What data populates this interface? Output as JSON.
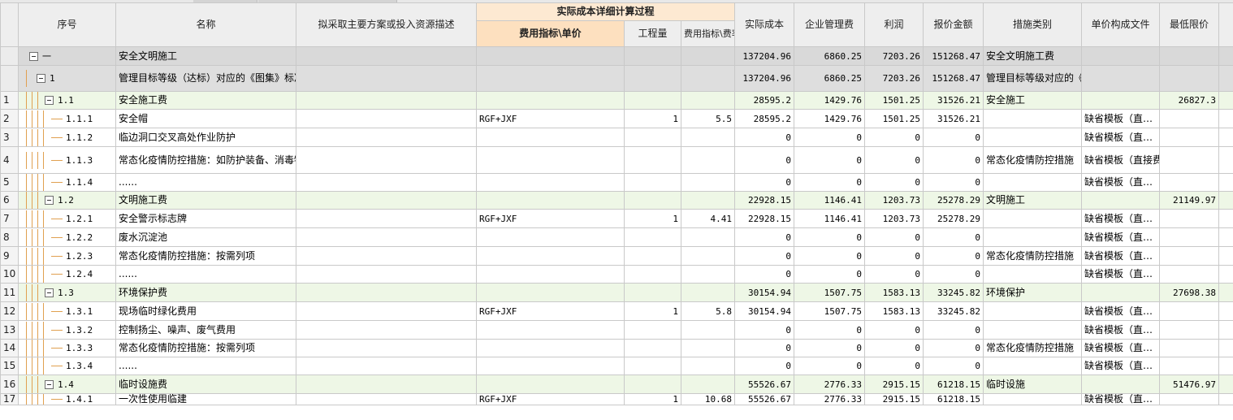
{
  "columns": {
    "seq": "序号",
    "name": "名称",
    "plan": "拟采取主要方案或投入资源描述",
    "group": "实际成本详细计算过程",
    "indicator": "费用指标\\单价",
    "quantity": "工程量",
    "rate": "费用指标\\费率(%)",
    "actual_cost": "实际成本",
    "mgmt_fee": "企业管理费",
    "profit": "利润",
    "quote": "报价金额",
    "category": "措施类别",
    "unit_doc": "单价构成文件",
    "min_price": "最低限价"
  },
  "rows": [
    {
      "idx": "",
      "code": "一",
      "level": 0,
      "toggle": true,
      "name": "安全文明施工",
      "plan": "",
      "indicator": "",
      "qty": "",
      "rate": "",
      "cost": "137204.96",
      "mgmt": "6860.25",
      "profit": "7203.26",
      "quote": "151268.47",
      "category": "安全文明施工费",
      "unitdoc": "",
      "minprice": ""
    },
    {
      "idx": "",
      "code": "1",
      "level": 1,
      "toggle": true,
      "name": "管理目标等级（达标）对应的《图集》标准内项目措施费",
      "plan": "",
      "indicator": "",
      "qty": "",
      "rate": "",
      "cost": "137204.96",
      "mgmt": "6860.25",
      "profit": "7203.26",
      "quote": "151268.47",
      "category": "管理目标等级对应的《图集》标准内项…",
      "unitdoc": "",
      "minprice": ""
    },
    {
      "idx": "1",
      "code": "1.1",
      "level": 2,
      "toggle": true,
      "name": "安全施工费",
      "plan": "",
      "indicator": "",
      "qty": "",
      "rate": "",
      "cost": "28595.2",
      "mgmt": "1429.76",
      "profit": "1501.25",
      "quote": "31526.21",
      "category": "安全施工",
      "unitdoc": "",
      "minprice": "26827.3"
    },
    {
      "idx": "2",
      "code": "1.1.1",
      "level": 3,
      "toggle": false,
      "name": "安全帽",
      "plan": "",
      "indicator": "RGF+JXF",
      "qty": "1",
      "rate": "5.5",
      "cost": "28595.2",
      "mgmt": "1429.76",
      "profit": "1501.25",
      "quote": "31526.21",
      "category": "",
      "unitdoc": "缺省模板（直…",
      "minprice": ""
    },
    {
      "idx": "3",
      "code": "1.1.2",
      "level": 3,
      "toggle": false,
      "name": "临边洞口交叉高处作业防护",
      "plan": "",
      "indicator": "",
      "qty": "",
      "rate": "",
      "cost": "0",
      "mgmt": "0",
      "profit": "0",
      "quote": "0",
      "category": "",
      "unitdoc": "缺省模板（直…",
      "minprice": ""
    },
    {
      "idx": "4",
      "code": "1.1.3",
      "level": 3,
      "toggle": false,
      "name": "常态化疫情防控措施：如防护装备、消毒物资...",
      "plan": "",
      "indicator": "",
      "qty": "",
      "rate": "",
      "cost": "0",
      "mgmt": "0",
      "profit": "0",
      "quote": "0",
      "category": "常态化疫情防控措施",
      "unitdoc": "缺省模板（直接费取费）",
      "minprice": ""
    },
    {
      "idx": "5",
      "code": "1.1.4",
      "level": 3,
      "toggle": false,
      "name": "......",
      "plan": "",
      "indicator": "",
      "qty": "",
      "rate": "",
      "cost": "0",
      "mgmt": "0",
      "profit": "0",
      "quote": "0",
      "category": "",
      "unitdoc": "缺省模板（直…",
      "minprice": ""
    },
    {
      "idx": "6",
      "code": "1.2",
      "level": 2,
      "toggle": true,
      "name": "文明施工费",
      "plan": "",
      "indicator": "",
      "qty": "",
      "rate": "",
      "cost": "22928.15",
      "mgmt": "1146.41",
      "profit": "1203.73",
      "quote": "25278.29",
      "category": "文明施工",
      "unitdoc": "",
      "minprice": "21149.97"
    },
    {
      "idx": "7",
      "code": "1.2.1",
      "level": 3,
      "toggle": false,
      "name": "安全警示标志牌",
      "plan": "",
      "indicator": "RGF+JXF",
      "qty": "1",
      "rate": "4.41",
      "cost": "22928.15",
      "mgmt": "1146.41",
      "profit": "1203.73",
      "quote": "25278.29",
      "category": "",
      "unitdoc": "缺省模板（直…",
      "minprice": ""
    },
    {
      "idx": "8",
      "code": "1.2.2",
      "level": 3,
      "toggle": false,
      "name": "废水沉淀池",
      "plan": "",
      "indicator": "",
      "qty": "",
      "rate": "",
      "cost": "0",
      "mgmt": "0",
      "profit": "0",
      "quote": "0",
      "category": "",
      "unitdoc": "缺省模板（直…",
      "minprice": ""
    },
    {
      "idx": "9",
      "code": "1.2.3",
      "level": 3,
      "toggle": false,
      "name": "常态化疫情防控措施：按需列项",
      "plan": "",
      "indicator": "",
      "qty": "",
      "rate": "",
      "cost": "0",
      "mgmt": "0",
      "profit": "0",
      "quote": "0",
      "category": "常态化疫情防控措施",
      "unitdoc": "缺省模板（直…",
      "minprice": ""
    },
    {
      "idx": "10",
      "code": "1.2.4",
      "level": 3,
      "toggle": false,
      "name": "......",
      "plan": "",
      "indicator": "",
      "qty": "",
      "rate": "",
      "cost": "0",
      "mgmt": "0",
      "profit": "0",
      "quote": "0",
      "category": "",
      "unitdoc": "缺省模板（直…",
      "minprice": ""
    },
    {
      "idx": "11",
      "code": "1.3",
      "level": 2,
      "toggle": true,
      "name": "环境保护费",
      "plan": "",
      "indicator": "",
      "qty": "",
      "rate": "",
      "cost": "30154.94",
      "mgmt": "1507.75",
      "profit": "1583.13",
      "quote": "33245.82",
      "category": "环境保护",
      "unitdoc": "",
      "minprice": "27698.38"
    },
    {
      "idx": "12",
      "code": "1.3.1",
      "level": 3,
      "toggle": false,
      "name": "现场临时绿化费用",
      "plan": "",
      "indicator": "RGF+JXF",
      "qty": "1",
      "rate": "5.8",
      "cost": "30154.94",
      "mgmt": "1507.75",
      "profit": "1583.13",
      "quote": "33245.82",
      "category": "",
      "unitdoc": "缺省模板（直…",
      "minprice": ""
    },
    {
      "idx": "13",
      "code": "1.3.2",
      "level": 3,
      "toggle": false,
      "name": "控制扬尘、噪声、废气费用",
      "plan": "",
      "indicator": "",
      "qty": "",
      "rate": "",
      "cost": "0",
      "mgmt": "0",
      "profit": "0",
      "quote": "0",
      "category": "",
      "unitdoc": "缺省模板（直…",
      "minprice": ""
    },
    {
      "idx": "14",
      "code": "1.3.3",
      "level": 3,
      "toggle": false,
      "name": "常态化疫情防控措施：按需列项",
      "plan": "",
      "indicator": "",
      "qty": "",
      "rate": "",
      "cost": "0",
      "mgmt": "0",
      "profit": "0",
      "quote": "0",
      "category": "常态化疫情防控措施",
      "unitdoc": "缺省模板（直…",
      "minprice": ""
    },
    {
      "idx": "15",
      "code": "1.3.4",
      "level": 3,
      "toggle": false,
      "name": "......",
      "plan": "",
      "indicator": "",
      "qty": "",
      "rate": "",
      "cost": "0",
      "mgmt": "0",
      "profit": "0",
      "quote": "0",
      "category": "",
      "unitdoc": "缺省模板（直…",
      "minprice": ""
    },
    {
      "idx": "16",
      "code": "1.4",
      "level": 2,
      "toggle": true,
      "name": "临时设施费",
      "plan": "",
      "indicator": "",
      "qty": "",
      "rate": "",
      "cost": "55526.67",
      "mgmt": "2776.33",
      "profit": "2915.15",
      "quote": "61218.15",
      "category": "临时设施",
      "unitdoc": "",
      "minprice": "51476.97"
    },
    {
      "idx": "17",
      "code": "1.4.1",
      "level": 3,
      "toggle": false,
      "name": "一次性使用临建",
      "plan": "",
      "indicator": "RGF+JXF",
      "qty": "1",
      "rate": "10.68",
      "cost": "55526.67",
      "mgmt": "2776.33",
      "profit": "2915.15",
      "quote": "61218.15",
      "category": "",
      "unitdoc": "缺省模板（直…",
      "minprice": ""
    }
  ]
}
